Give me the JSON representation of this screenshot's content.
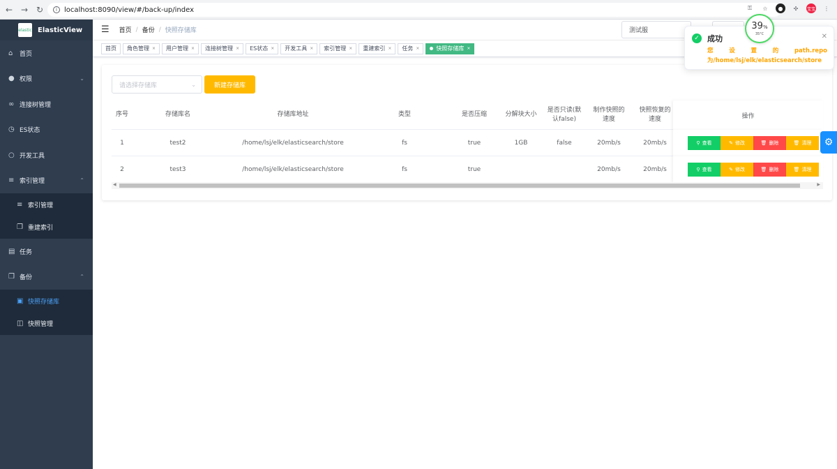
{
  "browser": {
    "url": "localhost:8090/view/#/back-up/index",
    "avatar_text": "宝宝"
  },
  "sidebar": {
    "app_name": "ElasticView",
    "logo_text": "elastic",
    "items": [
      {
        "label": "首页"
      },
      {
        "label": "权限"
      },
      {
        "label": "连接树管理"
      },
      {
        "label": "ES状态"
      },
      {
        "label": "开发工具"
      },
      {
        "label": "索引管理"
      },
      {
        "label": "索引管理"
      },
      {
        "label": "重建索引"
      },
      {
        "label": "任务"
      },
      {
        "label": "备份"
      },
      {
        "label": "快照存储库"
      },
      {
        "label": "快照管理"
      }
    ]
  },
  "header": {
    "breadcrumb": [
      "首页",
      "备份",
      "快照存储库"
    ],
    "env": "测试服"
  },
  "tags": [
    "首页",
    "角色管理",
    "用户管理",
    "连接树管理",
    "ES状态",
    "开发工具",
    "索引管理",
    "重建索引",
    "任务",
    "快照存储库"
  ],
  "toolbar": {
    "repo_placeholder": "请选择存储库",
    "new_label": "新建存储库"
  },
  "table": {
    "headers": [
      "序号",
      "存储库名",
      "存储库地址",
      "类型",
      "是否压缩",
      "分解块大小",
      "是否只读(默认false)",
      "制作快照的速度",
      "快照恢复的速度",
      "操作"
    ],
    "rows": [
      [
        "1",
        "test2",
        "/home/lsj/elk/elasticsearch/store",
        "fs",
        "true",
        "1GB",
        "false",
        "20mb/s",
        "20mb/s"
      ],
      [
        "2",
        "test3",
        "/home/lsj/elk/elasticsearch/store",
        "fs",
        "true",
        "",
        "",
        "20mb/s",
        "20mb/s"
      ]
    ],
    "actions": [
      "查看",
      "修改",
      "删除",
      "清理"
    ]
  },
  "notification": {
    "title": "成功",
    "msg_line1": "您 设 置 的 path.repo",
    "msg_line2": "为/home/lsj/elk/elasticsearch/store"
  },
  "cpu_widget": {
    "percent": "39",
    "unit": "%",
    "temp": "35°C"
  }
}
